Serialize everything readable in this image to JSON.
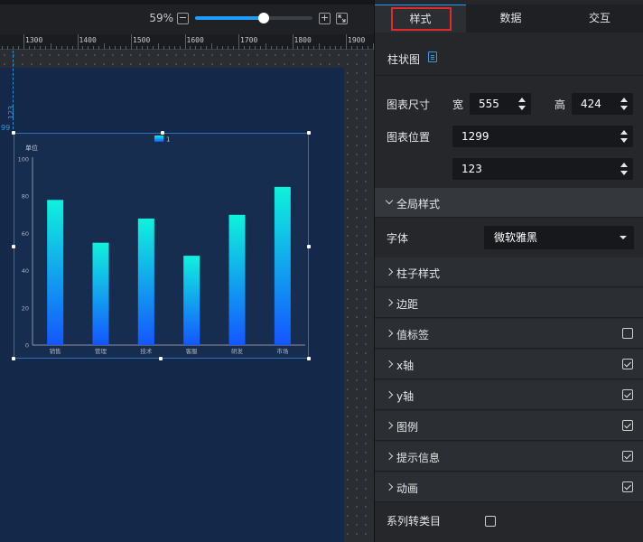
{
  "toolbar": {
    "zoom": "59%",
    "zoom_out": "−",
    "zoom_in": "+",
    "zoom_level": 0.59
  },
  "ruler": {
    "labels": [
      "1300",
      "1400",
      "1500",
      "1600",
      "1700",
      "1800",
      "1900"
    ]
  },
  "guides": {
    "vertical_value": "123",
    "horizontal_value": "99"
  },
  "chart_data": {
    "type": "bar",
    "title": "",
    "ylabel": "单位",
    "xlabel": "",
    "categories": [
      "销售",
      "管理",
      "技术",
      "客服",
      "研发",
      "市场"
    ],
    "series": [
      {
        "name": "1",
        "values": [
          78,
          55,
          68,
          48,
          70,
          85
        ]
      }
    ],
    "ylim": [
      0,
      100
    ],
    "yticks": [
      0,
      20,
      40,
      60,
      80,
      100
    ],
    "grid": false,
    "legend": "top-center",
    "colors": {
      "bar_top": "#10f2dc",
      "bar_bottom": "#1456ff",
      "axis": "#8a94a6"
    }
  },
  "panel": {
    "tabs": [
      {
        "label": "样式",
        "active": true
      },
      {
        "label": "数据",
        "active": false
      },
      {
        "label": "交互",
        "active": false
      }
    ],
    "component_title": "柱状图",
    "size": {
      "label": "图表尺寸",
      "width_label": "宽",
      "width": "555",
      "height_label": "高",
      "height": "424"
    },
    "position": {
      "label": "图表位置",
      "x": "1299",
      "y": "123"
    },
    "global_style": {
      "label": "全局样式",
      "font_label": "字体",
      "font_value": "微软雅黑"
    },
    "sections": [
      {
        "label": "柱子样式",
        "checkbox": null
      },
      {
        "label": "边距",
        "checkbox": null
      },
      {
        "label": "值标签",
        "checkbox": false
      },
      {
        "label": "x轴",
        "checkbox": true
      },
      {
        "label": "y轴",
        "checkbox": true
      },
      {
        "label": "图例",
        "checkbox": true
      },
      {
        "label": "提示信息",
        "checkbox": true
      },
      {
        "label": "动画",
        "checkbox": true
      }
    ],
    "series_to_category": {
      "label": "系列转类目",
      "checked": false
    }
  },
  "colors": {
    "accent": "#1f9dff",
    "highlight_border": "#e02b2b",
    "artboard": "#14294a",
    "panel": "#25272b"
  }
}
